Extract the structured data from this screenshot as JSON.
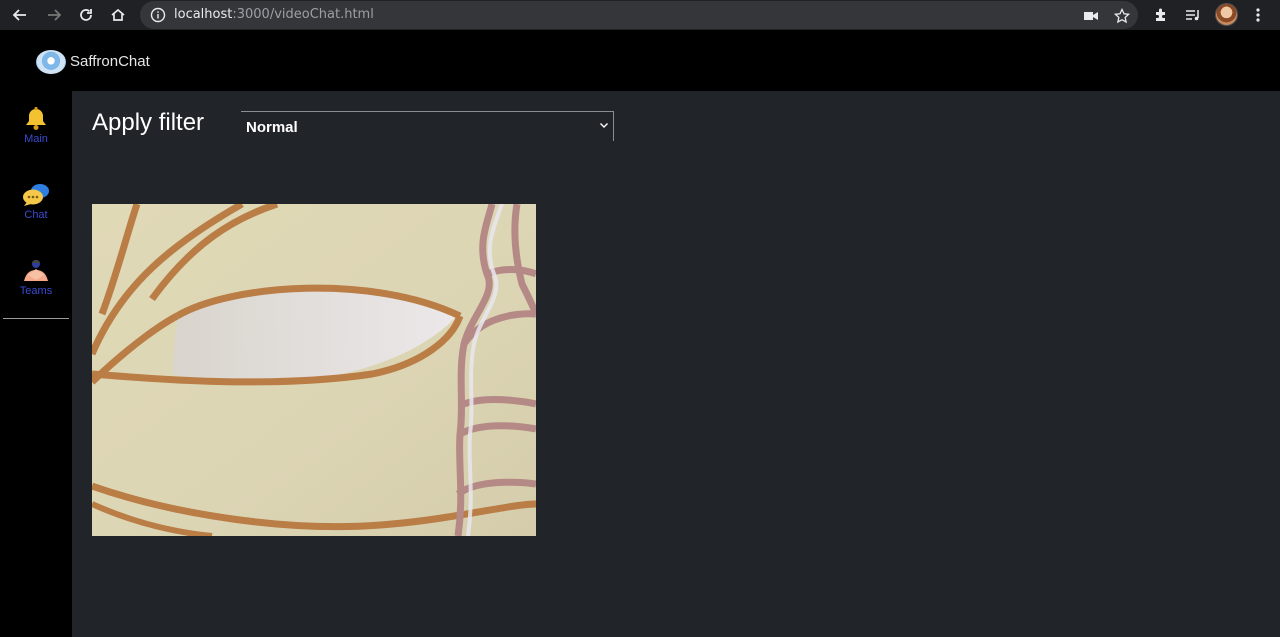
{
  "browser": {
    "url_host": "localhost",
    "url_rest": ":3000/videoChat.html"
  },
  "app": {
    "brand": "SaffronChat"
  },
  "sidebar": {
    "items": [
      {
        "label": "Main",
        "icon": "bell-icon"
      },
      {
        "label": "Chat",
        "icon": "chat-bubbles-icon"
      },
      {
        "label": "Teams",
        "icon": "teams-icon"
      }
    ]
  },
  "filter": {
    "label": "Apply filter",
    "selected": "Normal"
  },
  "colors": {
    "sidebar_label": "#3b4bd1",
    "main_bg": "#212529"
  }
}
